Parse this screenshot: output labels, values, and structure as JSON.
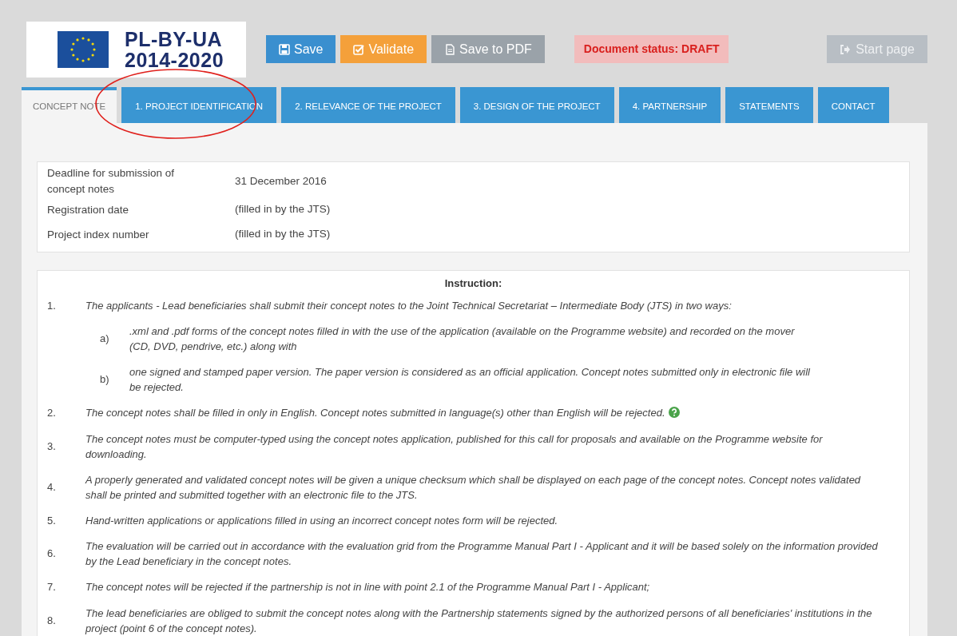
{
  "logo": {
    "line_1": "PL-BY-UA",
    "line_2": "2014-2020"
  },
  "toolbar": [
    {
      "kind": "save",
      "label": "Save",
      "disabled": false
    },
    {
      "kind": "validate",
      "label": "Validate",
      "disabled": false
    },
    {
      "kind": "pdf",
      "label": "Save to PDF",
      "disabled": true
    }
  ],
  "status": {
    "label": "Document status:",
    "value": "DRAFT"
  },
  "start_button": {
    "label": "Start page"
  },
  "tabs": [
    {
      "label": "CONCEPT NOTE",
      "selected": true,
      "highlighted": false
    },
    {
      "label": "1. PROJECT IDENTIFICATION",
      "selected": false,
      "highlighted": true
    },
    {
      "label": "2. RELEVANCE OF THE PROJECT",
      "selected": false,
      "highlighted": false
    },
    {
      "label": "3. DESIGN OF THE PROJECT",
      "selected": false,
      "highlighted": false
    },
    {
      "label": "4. PARTNERSHIP",
      "selected": false,
      "highlighted": false
    },
    {
      "label": "STATEMENTS",
      "selected": false,
      "highlighted": false
    },
    {
      "label": "CONTACT",
      "selected": false,
      "highlighted": false
    }
  ],
  "info": [
    {
      "label": "Deadline for submission of concept notes",
      "value": "31 December 2016"
    },
    {
      "label": "Registration date",
      "value": "(filled in by the JTS)"
    },
    {
      "label": "Project index number",
      "value": "(filled in by the JTS)"
    }
  ],
  "instruction": {
    "title": "Instruction:",
    "items": [
      {
        "number": "1.",
        "text": "The applicants - Lead beneficiaries shall submit their concept notes to the Joint Technical Secretariat – Intermediate Body (JTS) in two ways:",
        "help": false,
        "children": [
          {
            "number": "a)",
            "text": ".xml and .pdf forms of the concept notes filled in with the use of the application (available on the Programme website) and recorded on the mover (CD, DVD, pendrive, etc.) along with"
          },
          {
            "number": "b)",
            "text": "one signed and stamped paper version. The paper version is considered as an official application. Concept notes submitted only in electronic file will be rejected."
          }
        ]
      },
      {
        "number": "2.",
        "text": "The concept notes shall be filled in only in English. Concept notes submitted in language(s) other than English will be rejected.",
        "help": true
      },
      {
        "number": "3.",
        "text": "The concept notes must be computer-typed using the concept notes application, published for this call for proposals and available on the Programme website for downloading.",
        "help": false
      },
      {
        "number": "4.",
        "text": "A properly generated and validated concept notes will be given a unique checksum which shall be displayed on each page of the concept notes. Concept notes validated shall be printed and submitted together with an electronic file to the JTS.",
        "help": false
      },
      {
        "number": "5.",
        "text": "Hand-written applications or applications filled in using an incorrect concept notes form will be rejected.",
        "help": false
      },
      {
        "number": "6.",
        "text": "The evaluation will be carried out in accordance with the evaluation grid from the Programme Manual Part I - Applicant and it will be based solely on the information provided by the Lead beneficiary in the concept notes.",
        "help": false
      },
      {
        "number": "7.",
        "text": "The concept notes will be rejected if the partnership is not in line with point 2.1 of the Programme Manual Part I - Applicant;",
        "help": false
      },
      {
        "number": "8.",
        "text": "The lead beneficiaries are obliged to submit the concept notes along with the Partnership statements signed by the authorized persons of all beneficiaries' institutions in the project (point 6 of the concept notes).",
        "help": false
      }
    ]
  }
}
